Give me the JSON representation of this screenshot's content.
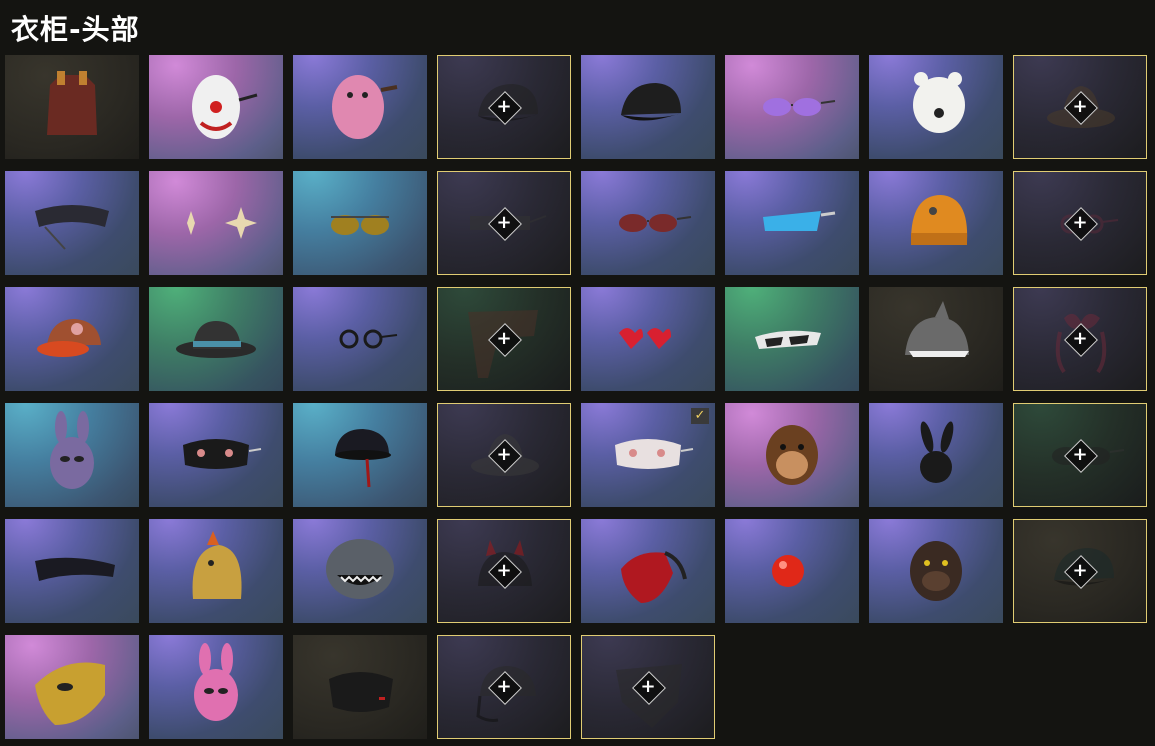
{
  "header": {
    "title": "衣柜-头部"
  },
  "plus_glyph": "+",
  "check_glyph": "✓",
  "items": [
    {
      "name": "red-hood-item",
      "bg": "dark",
      "locked": false,
      "icon": "hood-icon",
      "color": "#6a2a22"
    },
    {
      "name": "clown-mask-item",
      "bg": "pink",
      "locked": false,
      "icon": "clown-mask-icon",
      "color": "#f0f0f0"
    },
    {
      "name": "pink-hippo-mask-item",
      "bg": "purple",
      "locked": false,
      "icon": "hippo-mask-icon",
      "color": "#e088b0"
    },
    {
      "name": "black-cap-locked-item",
      "bg": "locked",
      "locked": true,
      "icon": "cap-icon",
      "color": "#222"
    },
    {
      "name": "black-cap-item",
      "bg": "purple",
      "locked": false,
      "icon": "cap-icon",
      "color": "#1e1e1e"
    },
    {
      "name": "purple-sunglasses-item",
      "bg": "pink",
      "locked": false,
      "icon": "sunglasses-icon",
      "color": "#a070e0"
    },
    {
      "name": "polar-bear-mask-item",
      "bg": "purple",
      "locked": false,
      "icon": "bear-mask-icon",
      "color": "#f2f2ee"
    },
    {
      "name": "bucket-hat-locked-item",
      "bg": "locked",
      "locked": true,
      "icon": "hat-icon",
      "color": "#4a3b2a"
    },
    {
      "name": "tech-visor-item",
      "bg": "purple",
      "locked": false,
      "icon": "visor-icon",
      "color": "#2a2a33"
    },
    {
      "name": "star-earrings-item",
      "bg": "pink",
      "locked": false,
      "icon": "earrings-icon",
      "color": "#e8d8b0"
    },
    {
      "name": "aviator-glasses-item",
      "bg": "teal",
      "locked": false,
      "icon": "aviator-icon",
      "color": "#a08020"
    },
    {
      "name": "shutter-shades-locked-item",
      "bg": "locked",
      "locked": true,
      "icon": "shutter-shades-icon",
      "color": "#333"
    },
    {
      "name": "red-sunglasses-item",
      "bg": "purple",
      "locked": false,
      "icon": "sunglasses-icon",
      "color": "#7a2a2a"
    },
    {
      "name": "blue-shield-glasses-item",
      "bg": "purple",
      "locked": false,
      "icon": "shield-glasses-icon",
      "color": "#3ab0e8"
    },
    {
      "name": "orange-beanie-item",
      "bg": "purple",
      "locked": false,
      "icon": "beanie-icon",
      "color": "#e08a20"
    },
    {
      "name": "round-glasses-locked-item",
      "bg": "locked",
      "locked": true,
      "icon": "round-glasses-icon",
      "color": "#5a2a3a"
    },
    {
      "name": "orange-visor-cap-item",
      "bg": "purple",
      "locked": false,
      "icon": "visor-cap-icon",
      "color": "#d84a20"
    },
    {
      "name": "fedora-item",
      "bg": "green",
      "locked": false,
      "icon": "fedora-icon",
      "color": "#2a2a2a"
    },
    {
      "name": "small-round-glasses-item",
      "bg": "purple",
      "locked": false,
      "icon": "round-glasses-icon",
      "color": "#1a1a1a"
    },
    {
      "name": "scarf-locked-item",
      "bg": "locked-green",
      "locked": true,
      "icon": "scarf-icon",
      "color": "#4a3028"
    },
    {
      "name": "heart-glasses-item",
      "bg": "purple",
      "locked": false,
      "icon": "heart-glasses-icon",
      "color": "#d82030"
    },
    {
      "name": "white-sport-glasses-item",
      "bg": "green",
      "locked": false,
      "icon": "sport-glasses-icon",
      "color": "#e8e8e8"
    },
    {
      "name": "shark-hat-item",
      "bg": "dark",
      "locked": false,
      "icon": "shark-hat-icon",
      "color": "#6a6a6a"
    },
    {
      "name": "bow-headband-locked-item",
      "bg": "locked",
      "locked": true,
      "icon": "bow-icon",
      "color": "#6a2a3a"
    },
    {
      "name": "bunny-hood-mask-item",
      "bg": "teal",
      "locked": false,
      "icon": "bunny-hood-icon",
      "color": "#7a6aa0"
    },
    {
      "name": "cat-sleep-mask-item",
      "bg": "purple",
      "locked": false,
      "icon": "sleep-mask-icon",
      "color": "#1a1a1a"
    },
    {
      "name": "helmet-item",
      "bg": "teal",
      "locked": false,
      "icon": "helmet-icon",
      "color": "#1a1a22"
    },
    {
      "name": "tweed-hat-locked-item",
      "bg": "locked",
      "locked": true,
      "icon": "hat-icon",
      "color": "#3a3a3a"
    },
    {
      "name": "kitty-sleep-mask-item",
      "bg": "purple",
      "locked": false,
      "checked": true,
      "icon": "sleep-mask-icon",
      "color": "#e8e0e0"
    },
    {
      "name": "chimp-mask-item",
      "bg": "pink",
      "locked": false,
      "icon": "chimp-mask-icon",
      "color": "#6a4020"
    },
    {
      "name": "black-bunny-mask-item",
      "bg": "purple",
      "locked": false,
      "icon": "bunny-mask-icon",
      "color": "#1a1a1a"
    },
    {
      "name": "sunglasses-locked-item",
      "bg": "locked-green",
      "locked": true,
      "icon": "sunglasses-icon",
      "color": "#222"
    },
    {
      "name": "wrap-visor-item",
      "bg": "purple",
      "locked": false,
      "icon": "wrap-visor-icon",
      "color": "#1a1a22"
    },
    {
      "name": "dino-mask-item",
      "bg": "purple",
      "locked": false,
      "icon": "dino-mask-icon",
      "color": "#c8a040"
    },
    {
      "name": "shark-mask-item",
      "bg": "purple",
      "locked": false,
      "icon": "shark-mask-icon",
      "color": "#5a6068"
    },
    {
      "name": "devil-cap-locked-item",
      "bg": "locked",
      "locked": true,
      "icon": "devil-cap-icon",
      "color": "#1a1a1a"
    },
    {
      "name": "red-half-mask-item",
      "bg": "purple",
      "locked": false,
      "icon": "half-mask-icon",
      "color": "#b01820"
    },
    {
      "name": "clown-nose-item",
      "bg": "purple",
      "locked": false,
      "icon": "nose-icon",
      "color": "#e02818"
    },
    {
      "name": "bulldog-mask-item",
      "bg": "purple",
      "locked": false,
      "icon": "dog-mask-icon",
      "color": "#3a2a22"
    },
    {
      "name": "dark-cap-locked-item",
      "bg": "dark",
      "locked": true,
      "icon": "cap-icon",
      "color": "#1a2a2a"
    },
    {
      "name": "gold-mask-item",
      "bg": "pink",
      "locked": false,
      "icon": "gold-mask-icon",
      "color": "#c8a030"
    },
    {
      "name": "pink-bunny-hood-item",
      "bg": "purple",
      "locked": false,
      "icon": "bunny-hood-icon",
      "color": "#e070b0"
    },
    {
      "name": "face-mask-item",
      "bg": "dark",
      "locked": false,
      "icon": "face-mask-icon",
      "color": "#1a1a1a"
    },
    {
      "name": "headset-cap-locked-item",
      "bg": "locked",
      "locked": true,
      "icon": "headset-icon",
      "color": "#2a2a2a"
    },
    {
      "name": "bandana-locked-item",
      "bg": "locked",
      "locked": true,
      "icon": "bandana-icon",
      "color": "#2a2a2a"
    }
  ]
}
